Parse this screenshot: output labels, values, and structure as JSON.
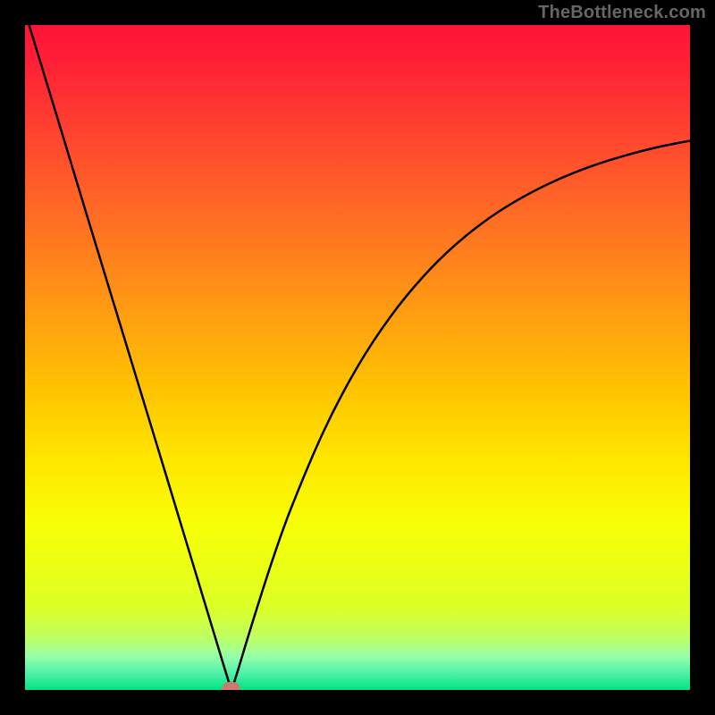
{
  "watermark": "TheBottleneck.com",
  "chart_data": {
    "type": "line",
    "title": "",
    "xlabel": "",
    "ylabel": "",
    "x_range": [
      0,
      100
    ],
    "y_range": [
      0,
      100
    ],
    "grid": false,
    "marker": {
      "x": 31,
      "y": 0.3
    },
    "curve": {
      "name": "bottleneck-curve",
      "x": [
        0,
        5,
        10,
        15,
        20,
        25,
        28,
        30,
        30.8,
        31,
        31.3,
        32,
        34,
        37,
        40,
        45,
        50,
        55,
        60,
        65,
        70,
        75,
        80,
        85,
        90,
        95,
        100
      ],
      "y": [
        102,
        85.6,
        69.1,
        52.7,
        36.3,
        19.8,
        9.9,
        3.3,
        0.7,
        0.2,
        0.7,
        2.9,
        9.5,
        18.9,
        27.3,
        39.1,
        48.6,
        56.2,
        62.3,
        67.2,
        71.1,
        74.2,
        76.7,
        78.7,
        80.3,
        81.6,
        82.6
      ]
    },
    "background_gradient": {
      "stops": [
        {
          "offset": 0.0,
          "color": "#ff1437"
        },
        {
          "offset": 0.05,
          "color": "#ff1e36"
        },
        {
          "offset": 0.15,
          "color": "#ff3f30"
        },
        {
          "offset": 0.25,
          "color": "#ff6028"
        },
        {
          "offset": 0.35,
          "color": "#ff811c"
        },
        {
          "offset": 0.45,
          "color": "#ffa30f"
        },
        {
          "offset": 0.55,
          "color": "#ffc400"
        },
        {
          "offset": 0.65,
          "color": "#ffe500"
        },
        {
          "offset": 0.75,
          "color": "#f8ff06"
        },
        {
          "offset": 0.82,
          "color": "#e9ff16"
        },
        {
          "offset": 0.88,
          "color": "#daff2a"
        },
        {
          "offset": 0.92,
          "color": "#bfff61"
        },
        {
          "offset": 0.95,
          "color": "#96ffa8"
        },
        {
          "offset": 0.975,
          "color": "#4ef0a9"
        },
        {
          "offset": 1.0,
          "color": "#00e47f"
        }
      ]
    }
  }
}
